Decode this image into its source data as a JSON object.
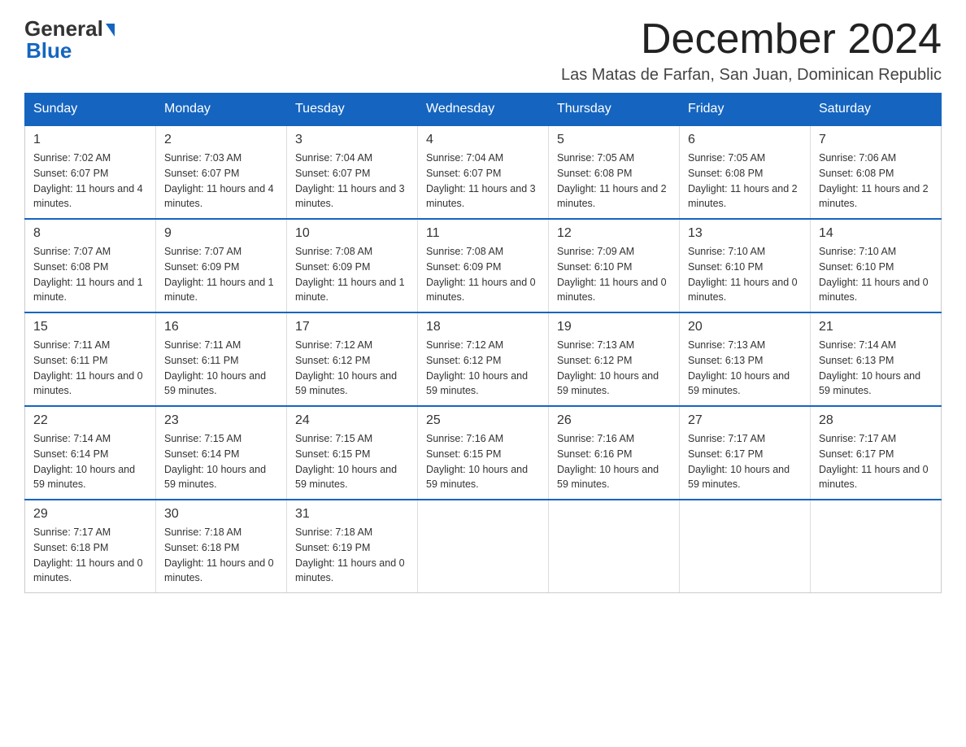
{
  "logo": {
    "line1": "General",
    "triangle": true,
    "line2": "Blue"
  },
  "title": "December 2024",
  "subtitle": "Las Matas de Farfan, San Juan, Dominican Republic",
  "days_of_week": [
    "Sunday",
    "Monday",
    "Tuesday",
    "Wednesday",
    "Thursday",
    "Friday",
    "Saturday"
  ],
  "weeks": [
    [
      {
        "day": "1",
        "sunrise": "7:02 AM",
        "sunset": "6:07 PM",
        "daylight": "11 hours and 4 minutes."
      },
      {
        "day": "2",
        "sunrise": "7:03 AM",
        "sunset": "6:07 PM",
        "daylight": "11 hours and 4 minutes."
      },
      {
        "day": "3",
        "sunrise": "7:04 AM",
        "sunset": "6:07 PM",
        "daylight": "11 hours and 3 minutes."
      },
      {
        "day": "4",
        "sunrise": "7:04 AM",
        "sunset": "6:07 PM",
        "daylight": "11 hours and 3 minutes."
      },
      {
        "day": "5",
        "sunrise": "7:05 AM",
        "sunset": "6:08 PM",
        "daylight": "11 hours and 2 minutes."
      },
      {
        "day": "6",
        "sunrise": "7:05 AM",
        "sunset": "6:08 PM",
        "daylight": "11 hours and 2 minutes."
      },
      {
        "day": "7",
        "sunrise": "7:06 AM",
        "sunset": "6:08 PM",
        "daylight": "11 hours and 2 minutes."
      }
    ],
    [
      {
        "day": "8",
        "sunrise": "7:07 AM",
        "sunset": "6:08 PM",
        "daylight": "11 hours and 1 minute."
      },
      {
        "day": "9",
        "sunrise": "7:07 AM",
        "sunset": "6:09 PM",
        "daylight": "11 hours and 1 minute."
      },
      {
        "day": "10",
        "sunrise": "7:08 AM",
        "sunset": "6:09 PM",
        "daylight": "11 hours and 1 minute."
      },
      {
        "day": "11",
        "sunrise": "7:08 AM",
        "sunset": "6:09 PM",
        "daylight": "11 hours and 0 minutes."
      },
      {
        "day": "12",
        "sunrise": "7:09 AM",
        "sunset": "6:10 PM",
        "daylight": "11 hours and 0 minutes."
      },
      {
        "day": "13",
        "sunrise": "7:10 AM",
        "sunset": "6:10 PM",
        "daylight": "11 hours and 0 minutes."
      },
      {
        "day": "14",
        "sunrise": "7:10 AM",
        "sunset": "6:10 PM",
        "daylight": "11 hours and 0 minutes."
      }
    ],
    [
      {
        "day": "15",
        "sunrise": "7:11 AM",
        "sunset": "6:11 PM",
        "daylight": "11 hours and 0 minutes."
      },
      {
        "day": "16",
        "sunrise": "7:11 AM",
        "sunset": "6:11 PM",
        "daylight": "10 hours and 59 minutes."
      },
      {
        "day": "17",
        "sunrise": "7:12 AM",
        "sunset": "6:12 PM",
        "daylight": "10 hours and 59 minutes."
      },
      {
        "day": "18",
        "sunrise": "7:12 AM",
        "sunset": "6:12 PM",
        "daylight": "10 hours and 59 minutes."
      },
      {
        "day": "19",
        "sunrise": "7:13 AM",
        "sunset": "6:12 PM",
        "daylight": "10 hours and 59 minutes."
      },
      {
        "day": "20",
        "sunrise": "7:13 AM",
        "sunset": "6:13 PM",
        "daylight": "10 hours and 59 minutes."
      },
      {
        "day": "21",
        "sunrise": "7:14 AM",
        "sunset": "6:13 PM",
        "daylight": "10 hours and 59 minutes."
      }
    ],
    [
      {
        "day": "22",
        "sunrise": "7:14 AM",
        "sunset": "6:14 PM",
        "daylight": "10 hours and 59 minutes."
      },
      {
        "day": "23",
        "sunrise": "7:15 AM",
        "sunset": "6:14 PM",
        "daylight": "10 hours and 59 minutes."
      },
      {
        "day": "24",
        "sunrise": "7:15 AM",
        "sunset": "6:15 PM",
        "daylight": "10 hours and 59 minutes."
      },
      {
        "day": "25",
        "sunrise": "7:16 AM",
        "sunset": "6:15 PM",
        "daylight": "10 hours and 59 minutes."
      },
      {
        "day": "26",
        "sunrise": "7:16 AM",
        "sunset": "6:16 PM",
        "daylight": "10 hours and 59 minutes."
      },
      {
        "day": "27",
        "sunrise": "7:17 AM",
        "sunset": "6:17 PM",
        "daylight": "10 hours and 59 minutes."
      },
      {
        "day": "28",
        "sunrise": "7:17 AM",
        "sunset": "6:17 PM",
        "daylight": "11 hours and 0 minutes."
      }
    ],
    [
      {
        "day": "29",
        "sunrise": "7:17 AM",
        "sunset": "6:18 PM",
        "daylight": "11 hours and 0 minutes."
      },
      {
        "day": "30",
        "sunrise": "7:18 AM",
        "sunset": "6:18 PM",
        "daylight": "11 hours and 0 minutes."
      },
      {
        "day": "31",
        "sunrise": "7:18 AM",
        "sunset": "6:19 PM",
        "daylight": "11 hours and 0 minutes."
      },
      null,
      null,
      null,
      null
    ]
  ]
}
